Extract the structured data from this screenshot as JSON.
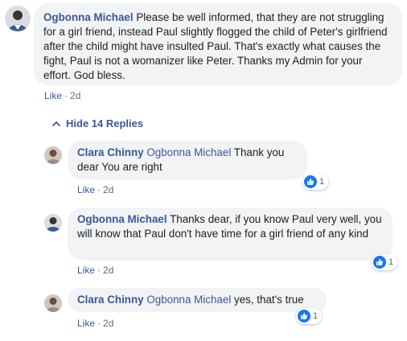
{
  "comment": {
    "author": "Ogbonna Michael",
    "text": " Please be well informed, that they are not struggling for a girl friend, instead Paul slightly flogged the child of Peter's girlfriend after the child might have insulted Paul. That's exactly what causes the fight, Paul is not a womanizer like Peter. Thanks my Admin for your effort. God bless.",
    "like_label": "Like",
    "time": "2d"
  },
  "replies_toggle": {
    "label": "Hide 14 Replies",
    "icon": "chevron-up-icon"
  },
  "replies": [
    {
      "author": "Clara Chinny",
      "mention": "Ogbonna Michael",
      "text": " Thank you dear You are right",
      "like_label": "Like",
      "time": "2d",
      "reaction_count": "1",
      "reaction_icon": "thumbs-up-icon"
    },
    {
      "author": "Ogbonna Michael",
      "mention": "",
      "text": " Thanks dear, if you know Paul very well, you will know that Paul don't have time for a girl friend of any kind",
      "like_label": "Like",
      "time": "2d",
      "reaction_count": "1",
      "reaction_icon": "thumbs-up-icon"
    },
    {
      "author": "Clara Chinny",
      "mention": "Ogbonna Michael",
      "text": " yes, that's true",
      "like_label": "Like",
      "time": "2d",
      "reaction_count": "1",
      "reaction_icon": "thumbs-up-icon"
    }
  ],
  "colors": {
    "link": "#385898",
    "bubble": "#f2f3f5",
    "meta": "#606770",
    "like_badge": "#1877f2"
  }
}
